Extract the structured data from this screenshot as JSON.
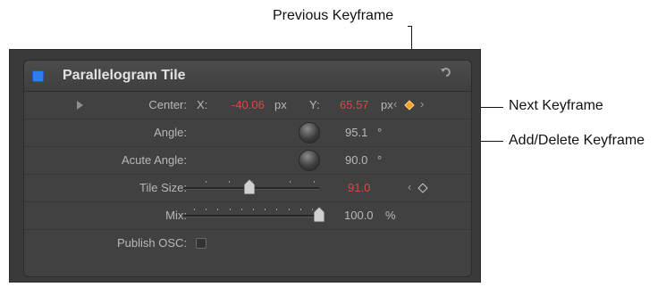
{
  "callouts": {
    "previous_keyframe": "Previous Keyframe",
    "next_keyframe": "Next Keyframe",
    "add_delete_keyframe": "Add/Delete Keyframe"
  },
  "panel": {
    "title": "Parallelogram Tile",
    "rows": {
      "center": {
        "label": "Center:",
        "x_label": "X:",
        "x_value": "-40.06",
        "x_unit": "px",
        "y_label": "Y:",
        "y_value": "65.57",
        "y_unit": "px"
      },
      "angle": {
        "label": "Angle:",
        "value": "95.1",
        "unit": "°"
      },
      "acute_angle": {
        "label": "Acute Angle:",
        "value": "90.0",
        "unit": "°"
      },
      "tile_size": {
        "label": "Tile Size:",
        "value": "91.0",
        "slider_fraction": 0.49
      },
      "mix": {
        "label": "Mix:",
        "value": "100.0",
        "unit": "%",
        "slider_fraction": 1.0
      },
      "publish_osc": {
        "label": "Publish OSC:",
        "checked": false
      }
    }
  },
  "colors": {
    "accent_blue": "#2d7ff0",
    "keyframe_orange": "#f0a030",
    "value_red": "#e04545"
  },
  "icons": {
    "reset": "reset-arrow-icon",
    "disclosure": "disclosure-triangle-icon",
    "keyframe": "keyframe-diamond-icon"
  }
}
